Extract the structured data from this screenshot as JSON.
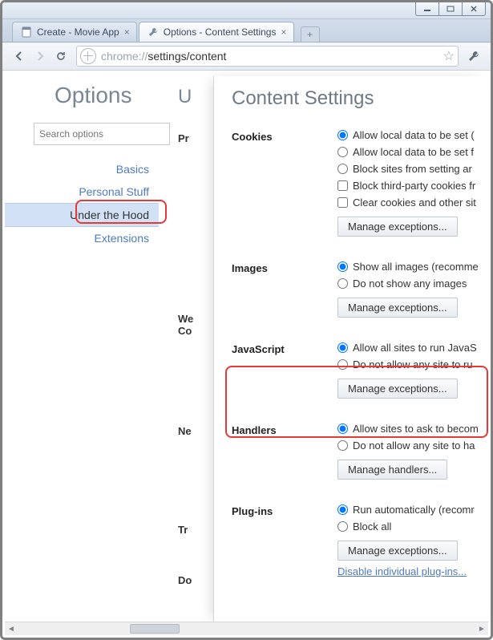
{
  "window": {
    "tabs": [
      {
        "label": "Create - Movie App"
      },
      {
        "label": "Options - Content Settings"
      }
    ]
  },
  "toolbar": {
    "url_proto": "chrome://",
    "url_rest": "settings/content"
  },
  "options": {
    "title": "Options",
    "search_placeholder": "Search options",
    "menu": {
      "basics": "Basics",
      "personal": "Personal Stuff",
      "under_hood": "Under the Hood",
      "extensions": "Extensions"
    },
    "mid": {
      "heading_cut": "U",
      "privacy": "Pr",
      "web": "We",
      "co": "Co",
      "ne": "Ne",
      "tr": "Tr",
      "do": "Do"
    }
  },
  "panel": {
    "title": "Content Settings",
    "cookies": {
      "heading": "Cookies",
      "opt1": "Allow local data to be set (",
      "opt2": "Allow local data to be set f",
      "opt3": "Block sites from setting ar",
      "opt4": "Block third-party cookies fr",
      "opt5": "Clear cookies and other sit",
      "manage": "Manage exceptions..."
    },
    "images": {
      "heading": "Images",
      "opt1": "Show all images (recomme",
      "opt2": "Do not show any images",
      "manage": "Manage exceptions..."
    },
    "javascript": {
      "heading": "JavaScript",
      "opt1": "Allow all sites to run JavaS",
      "opt2": "Do not allow any site to ru",
      "manage": "Manage exceptions..."
    },
    "handlers": {
      "heading": "Handlers",
      "opt1": "Allow sites to ask to becom",
      "opt2": "Do not allow any site to ha",
      "manage": "Manage handlers..."
    },
    "plugins": {
      "heading": "Plug-ins",
      "opt1": "Run automatically (recomr",
      "opt2": "Block all",
      "manage": "Manage exceptions...",
      "disable_link": "Disable individual plug-ins..."
    }
  }
}
